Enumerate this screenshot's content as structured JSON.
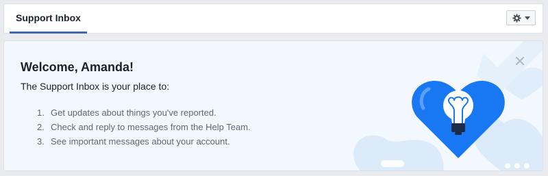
{
  "header": {
    "tab_label": "Support Inbox",
    "settings_icon": "gear-icon",
    "dropdown_icon": "caret-down-icon"
  },
  "welcome": {
    "title": "Welcome, Amanda!",
    "intro": "The Support Inbox is your place to:",
    "items": [
      {
        "number": "1.",
        "text": "Get updates about things you've reported."
      },
      {
        "number": "2.",
        "text": "Check and reply to messages from the Help Team."
      },
      {
        "number": "3.",
        "text": "See important messages about your account."
      }
    ],
    "close_icon": "close-icon",
    "illustration": "heart-lightbulb-illustration"
  },
  "colors": {
    "tab_underline": "#4267b2",
    "card_background": "#f2f8fd",
    "heart_blue": "#1877f2",
    "heart_light": "#dbebfa"
  }
}
